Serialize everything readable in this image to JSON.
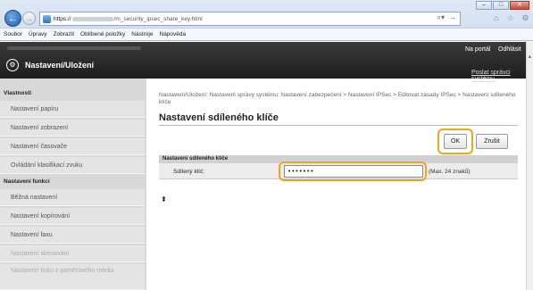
{
  "browser": {
    "address_prefix": "https://",
    "address_path": "/m_security_ipsec_share_key.html",
    "window_controls": [
      "min",
      "max",
      "close"
    ],
    "menu": [
      "Soubor",
      "Úpravy",
      "Zobrazit",
      "Oblíbené položky",
      "Nástroje",
      "Nápověda"
    ]
  },
  "header": {
    "title": "Nastavení/Uložení",
    "portal": "Na portál",
    "logout": "Odhlásit",
    "send_admin": "Poslat správci systému"
  },
  "sidebar": {
    "section1": "Vlastnosti",
    "items1": [
      "Nastavení papíru",
      "Nastavení zobrazení",
      "Nastavení časovače",
      "Ovládání klasifikací zvuku"
    ],
    "section2": "Nastavení funkcí",
    "items2": [
      "Běžná nastavení",
      "Nastavení kopírování",
      "Nastavení faxu",
      "Nastavení skenování",
      "Nastavení tisku z paměťového média"
    ]
  },
  "main": {
    "breadcrumb": "Nastavení/Uložení: Nastavení správy systému: Nastavení zabezpečení > Nastavení IPSec > Editovat zásady IPSec > Nastavení sdíleného klíče",
    "page_title": "Nastavení sdíleného klíče",
    "ok_label": "OK",
    "cancel_label": "Zrušit",
    "section_label": "Nastavení sdíleného klíče",
    "key_label": "Sdílený klíč:",
    "key_value": "•••••••",
    "max_note": "(Max. 24 znaků)",
    "top_icon": "⇞"
  }
}
